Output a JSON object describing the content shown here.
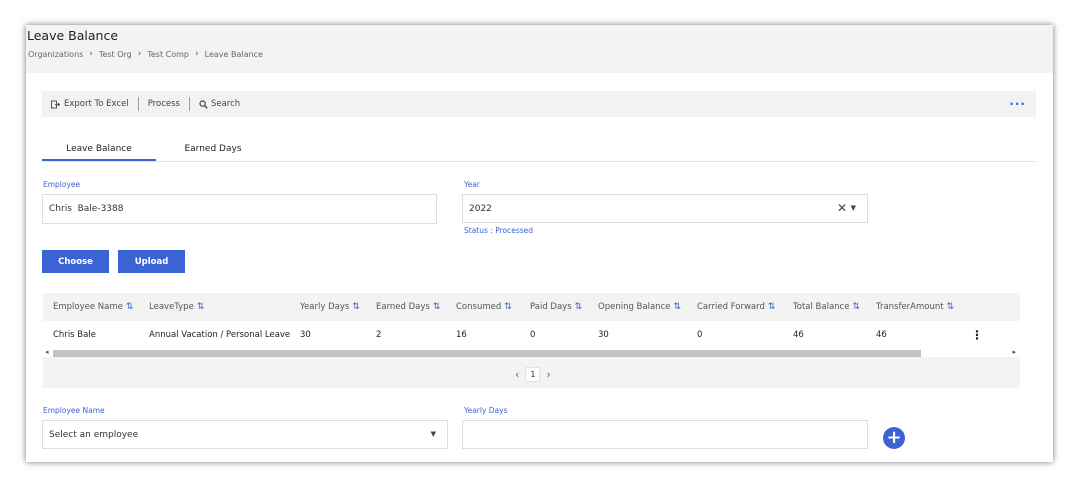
{
  "header": {
    "title": "Leave Balance",
    "breadcrumb": [
      "Organizations",
      "Test Org",
      "Test Comp",
      "Leave Balance"
    ]
  },
  "toolbar": {
    "export_label": "Export To Excel",
    "process_label": "Process",
    "search_label": "Search",
    "more_label": "···"
  },
  "tabs": [
    {
      "label": "Leave Balance",
      "active": true
    },
    {
      "label": "Earned Days",
      "active": false
    }
  ],
  "form": {
    "employee_label": "Employee",
    "employee_value": "Chris  Bale-3388",
    "year_label": "Year",
    "year_value": "2022",
    "status": "Status : Processed",
    "choose_label": "Choose",
    "upload_label": "Upload"
  },
  "grid": {
    "columns": [
      "Employee Name",
      "LeaveType",
      "Yearly Days",
      "Earned Days",
      "Consumed",
      "Paid Days",
      "Opening Balance",
      "Carried Forward",
      "Total Balance",
      "TransferAmount"
    ],
    "rows": [
      [
        "Chris Bale",
        "Annual Vacation / Personal Leave",
        "30",
        "2",
        "16",
        "0",
        "30",
        "0",
        "46",
        "46"
      ]
    ],
    "page": "1"
  },
  "add_form": {
    "employee_name_label": "Employee Name",
    "employee_placeholder": "Select an employee",
    "yearly_days_label": "Yearly Days",
    "yearly_days_value": ""
  },
  "colors": {
    "accent": "#3b63d3",
    "header_bg": "#f3f3f3"
  }
}
